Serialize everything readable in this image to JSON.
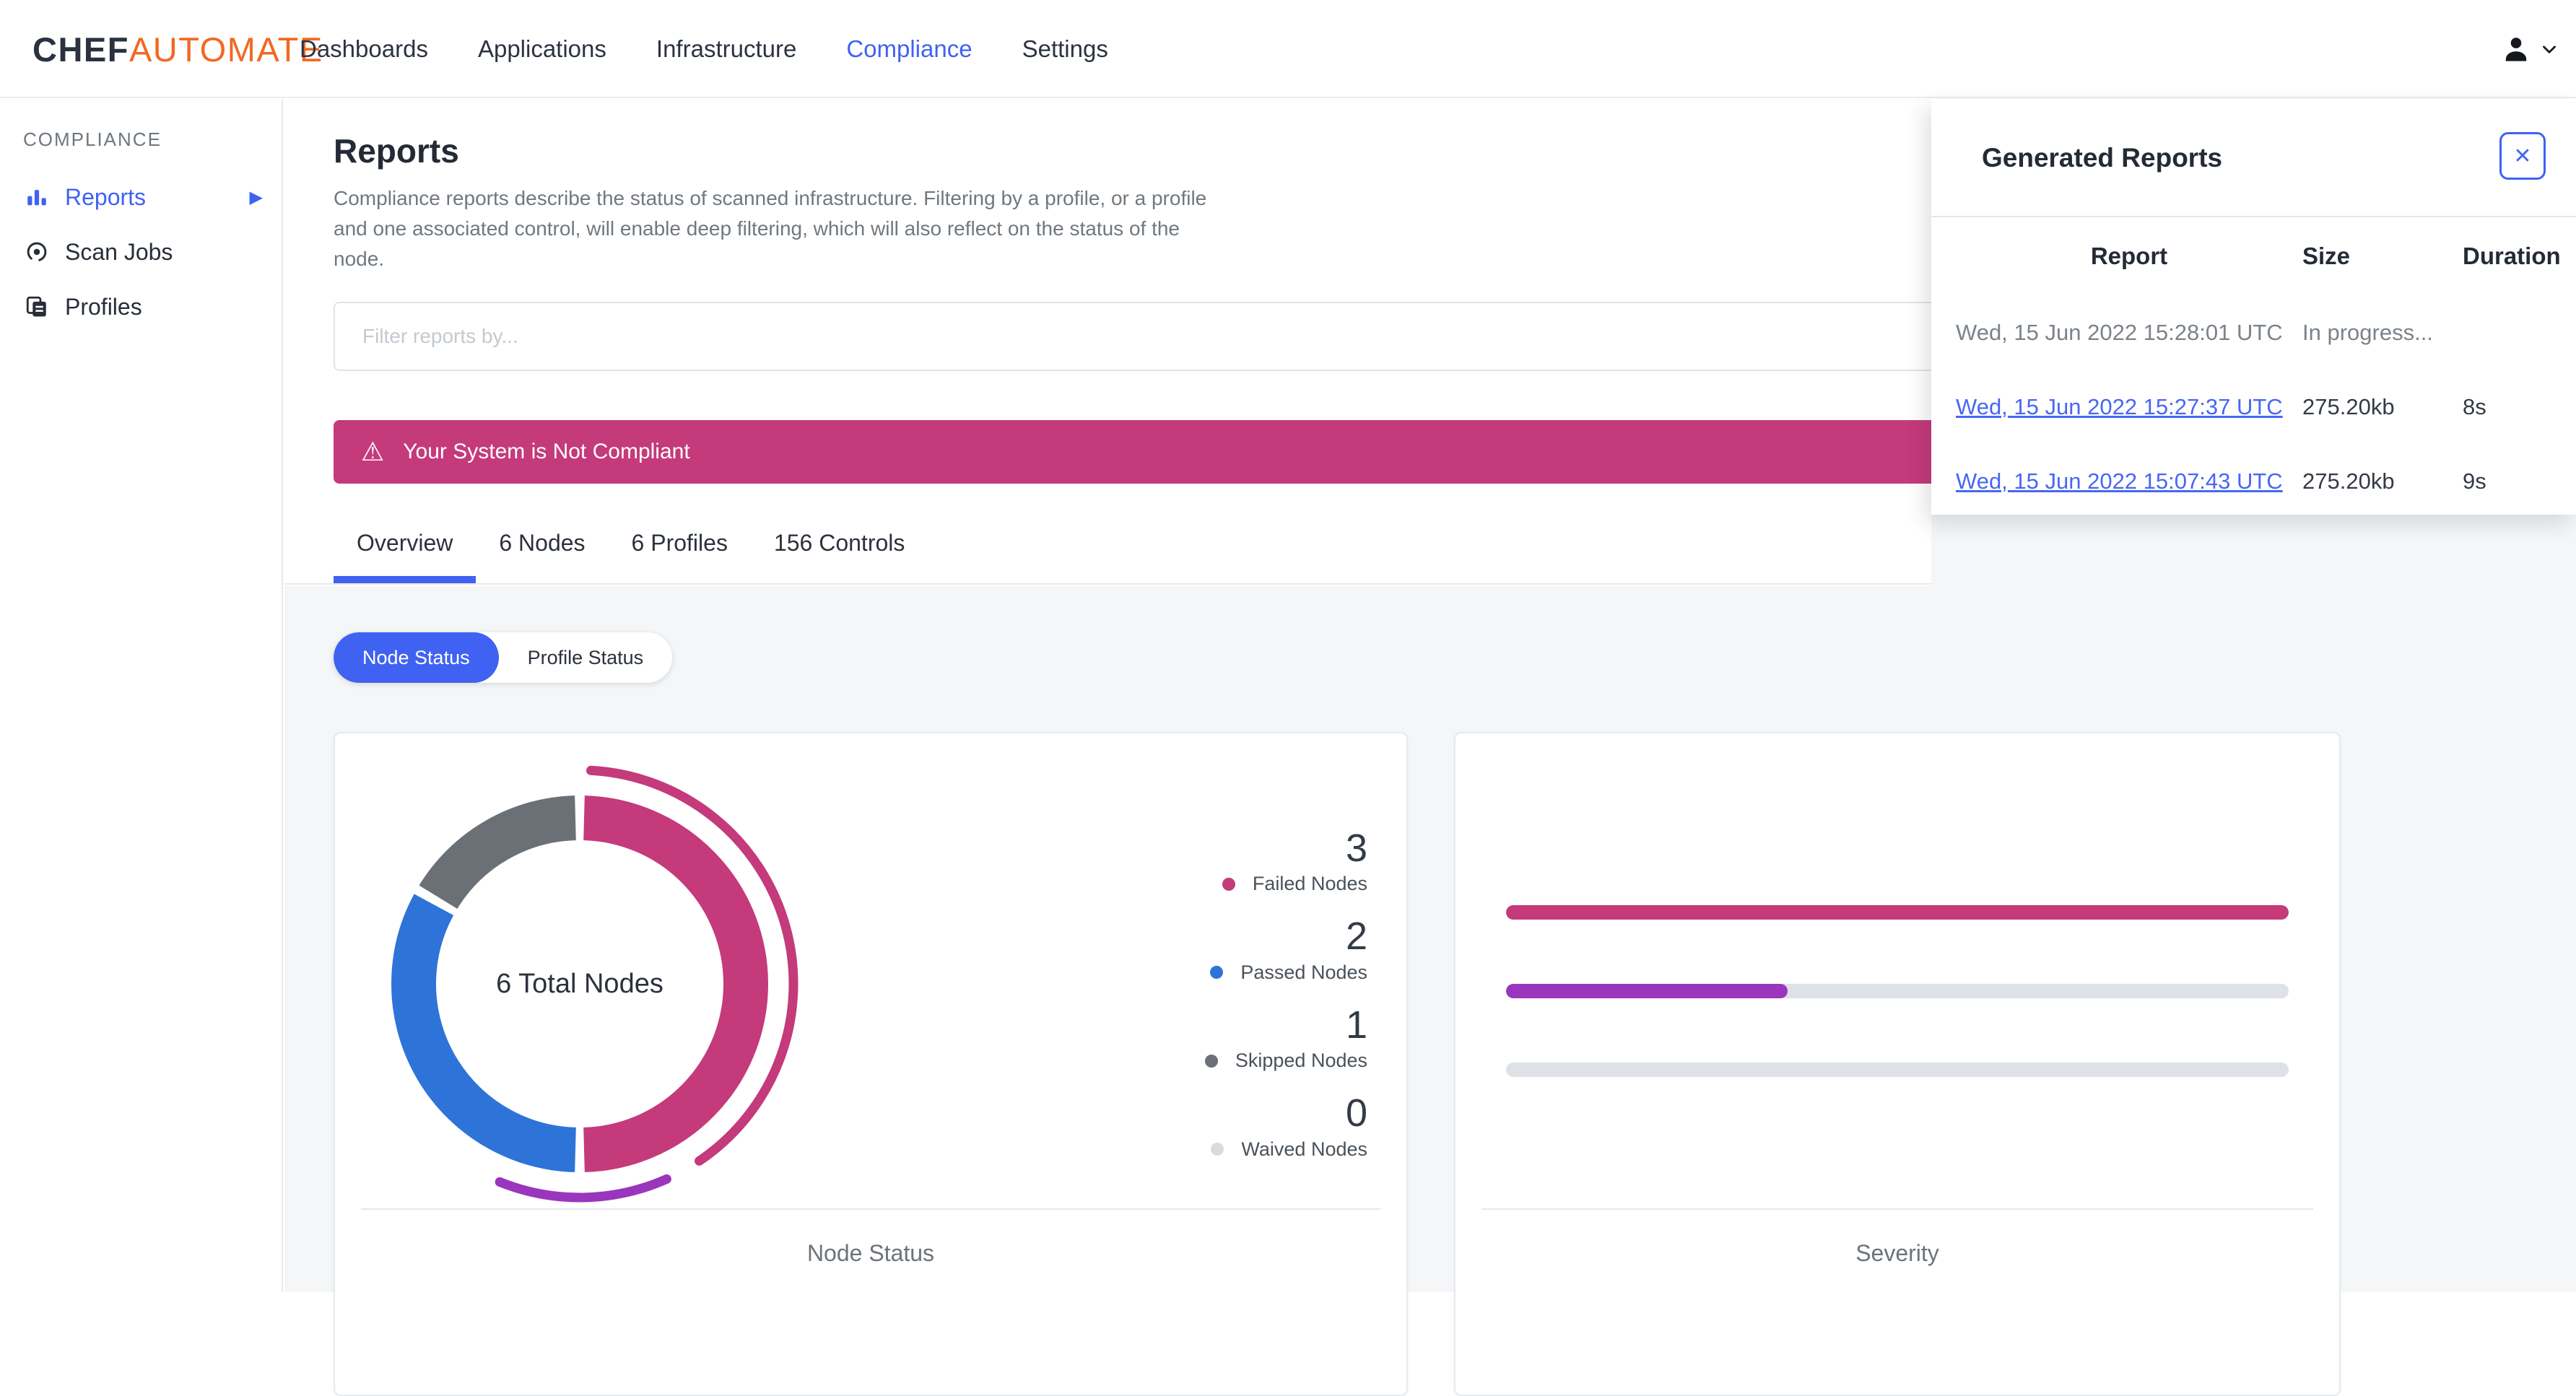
{
  "nav": {
    "logo_bold": "CHEF",
    "logo_accent": "AUTOMATE",
    "items": [
      {
        "label": "Dashboards"
      },
      {
        "label": "Applications"
      },
      {
        "label": "Infrastructure"
      },
      {
        "label": "Compliance",
        "active": true
      },
      {
        "label": "Settings"
      }
    ]
  },
  "sidebar": {
    "section": "COMPLIANCE",
    "items": [
      {
        "label": "Reports",
        "active": true,
        "icon": "bar-chart-icon",
        "has_submenu": true
      },
      {
        "label": "Scan Jobs",
        "icon": "scan-icon"
      },
      {
        "label": "Profiles",
        "icon": "profiles-icon"
      }
    ]
  },
  "main": {
    "title": "Reports",
    "description": "Compliance reports describe the status of scanned infrastructure. Filtering by a profile, or a profile and one associated control, will enable deep filtering, which will also reflect on the status of the node.",
    "filter_placeholder": "Filter reports by...",
    "alert_text": "Your System is Not Compliant",
    "tabs": [
      {
        "label": "Overview",
        "active": true
      },
      {
        "label": "6 Nodes"
      },
      {
        "label": "6 Profiles"
      },
      {
        "label": "156 Controls"
      }
    ],
    "toggle": [
      {
        "label": "Node Status",
        "active": true
      },
      {
        "label": "Profile Status"
      }
    ]
  },
  "generated_reports": {
    "title": "Generated Reports",
    "close_label": "✕",
    "columns": {
      "report": "Report",
      "size": "Size",
      "duration": "Duration"
    },
    "rows": [
      {
        "report": "Wed, 15 Jun 2022 15:28:01 UTC",
        "size": "In progress...",
        "duration": "",
        "is_link": false
      },
      {
        "report": "Wed, 15 Jun 2022 15:27:37 UTC",
        "size": "275.20kb",
        "duration": "8s",
        "is_link": true
      },
      {
        "report": "Wed, 15 Jun 2022 15:07:43 UTC",
        "size": "275.20kb",
        "duration": "9s",
        "is_link": true
      }
    ]
  },
  "chart_data": [
    {
      "type": "donut",
      "title": "Node Status",
      "center_label": "6 Total Nodes",
      "total": 6,
      "segments": [
        {
          "label": "Failed Nodes",
          "value": 3,
          "color": "#c43a7b"
        },
        {
          "label": "Passed Nodes",
          "value": 2,
          "color": "#2e74d8"
        },
        {
          "label": "Skipped Nodes",
          "value": 1,
          "color": "#6b7076"
        },
        {
          "label": "Waived Nodes",
          "value": 0,
          "color": "#d8dcdf"
        }
      ],
      "outer_arcs": [
        {
          "start_deg": 3,
          "end_deg": 146,
          "color": "#c43a7b"
        },
        {
          "start_deg": 156,
          "end_deg": 202,
          "color": "#9a36bd"
        }
      ],
      "legend_position": "right"
    },
    {
      "type": "bar",
      "orientation": "horizontal",
      "title": "Severity",
      "track_color": "#dee2e6",
      "bars": [
        {
          "fraction": 1.0,
          "color": "#c43a7b"
        },
        {
          "fraction": 0.36,
          "color": "#9a36bd"
        },
        {
          "fraction": 0.0,
          "color": null
        }
      ]
    }
  ],
  "colors": {
    "accent_blue": "#3f62f2",
    "link_blue": "#4767f2",
    "alert_pink": "#c43a7b",
    "donut_passed_blue": "#2e74d8",
    "donut_skipped_gray": "#6b7076",
    "outer_arc_purple": "#9a36bd",
    "page_background": "#f4f6f8",
    "logo_orange": "#f26822"
  }
}
